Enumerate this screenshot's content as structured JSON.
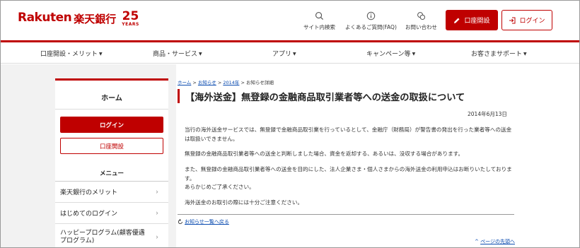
{
  "header": {
    "logo_brand": "Rakuten",
    "logo_bank": "楽天銀行",
    "logo_anniv_num": "25",
    "logo_anniv_label": "YEARS",
    "search_label": "サイト内検索",
    "faq_label": "よくあるご質問(FAQ)",
    "contact_label": "お問い合わせ",
    "open_account_label": "口座開設",
    "login_label": "ログイン"
  },
  "nav": {
    "items": [
      {
        "label": "口座開設・メリット"
      },
      {
        "label": "商品・サービス"
      },
      {
        "label": "アプリ"
      },
      {
        "label": "キャンペーン等"
      },
      {
        "label": "お客さまサポート"
      }
    ],
    "caret": "▼"
  },
  "sidebar": {
    "home": "ホーム",
    "login": "ログイン",
    "open_account": "口座開設",
    "menu_title": "メニュー",
    "items": [
      {
        "label": "楽天銀行のメリット"
      },
      {
        "label": "はじめてのログイン"
      },
      {
        "label": "ハッピープログラム(顧客優遇プログラム)"
      }
    ]
  },
  "breadcrumb": {
    "home": "ホーム",
    "sep": " > ",
    "news": "お知らせ",
    "year": "2014年",
    "current": "お知らせ詳細"
  },
  "article": {
    "title": "【海外送金】無登録の金融商品取引業者等への送金の取扱について",
    "date": "2014年6月13日",
    "paragraphs": [
      "当行の海外送金サービスでは、無登録で金融商品取引業を行っているとして、金融庁（財務局）が警告書の発出を行った業者等への送金は取扱いできません。",
      "無登録の金融商品取引業者等への送金と判断しました場合、資金を返却する、あるいは、没収する場合があります。",
      "また、無登録の金融商品取引業者等への送金を目的にした、法人企業さま・個人さまからの海外送金の利用申込はお断りいたしております。\nあらかじめご了承ください。",
      "海外送金のお取引の際には十分ご注意ください。"
    ],
    "back_link": "お知らせ一覧へ戻る",
    "page_top_link": "ページの先頭へ"
  },
  "colors": {
    "brand_red": "#bf0000",
    "link_blue": "#0a4bb0",
    "band_gray": "#f2f2f2"
  }
}
